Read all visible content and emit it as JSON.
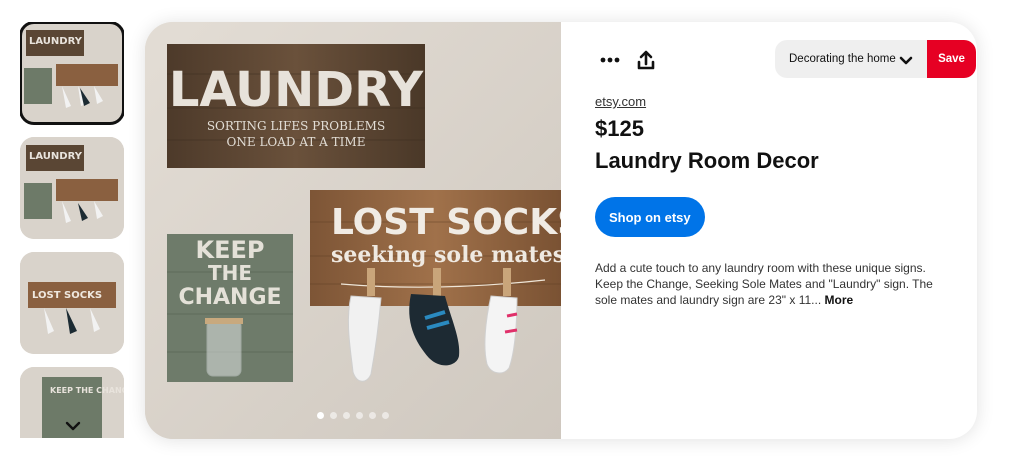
{
  "thumbnails": {
    "items": [
      {
        "name": "thumb-1",
        "selected": true,
        "sign_text": "LAUNDRY"
      },
      {
        "name": "thumb-2",
        "selected": false,
        "sign_text": "LAUNDRY"
      },
      {
        "name": "thumb-3",
        "selected": false,
        "sign_text": "LOST SOCKS"
      },
      {
        "name": "thumb-4",
        "selected": false,
        "sign_text": "KEEP THE CHANGE"
      }
    ],
    "scroll_icon": "chevron-down-icon"
  },
  "photo": {
    "signs": {
      "laundry": {
        "line1": "LAUNDRY",
        "line2": "SORTING LIFES PROBLEMS",
        "line3": "ONE LOAD AT A TIME"
      },
      "lost_socks": {
        "line1": "LOST SOCKS",
        "line2": "seeking sole mates"
      },
      "keep_change": {
        "line1": "KEEP",
        "line2": "THE",
        "line3": "CHANGE"
      }
    },
    "carousel": {
      "count": 6,
      "active_index": 0
    }
  },
  "toolbar": {
    "more_icon": "more-dots-icon",
    "share_icon": "share-upload-icon",
    "board_label": "Decorating the home",
    "board_icon": "chevron-down-icon",
    "save_label": "Save"
  },
  "product": {
    "source": "etsy.com",
    "price": "$125",
    "title": "Laundry Room Decor",
    "shop_label": "Shop on etsy",
    "description": "Add a cute touch to any laundry room with these unique signs. Keep the Change, Seeking Sole Mates and \"Laundry\" sign. The sole mates and laundry sign are 23\" x 11...",
    "more_label": "More"
  },
  "colors": {
    "save": "#e60023",
    "shop": "#0074e8"
  }
}
